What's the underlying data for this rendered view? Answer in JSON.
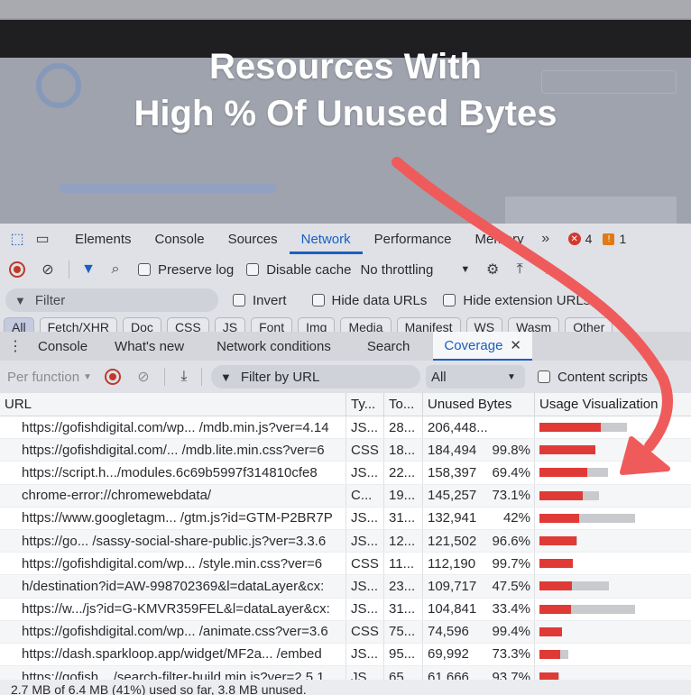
{
  "headline": {
    "line1": "Resources With",
    "line2": "High % Of Unused Bytes"
  },
  "devtools": {
    "main_tabs": [
      "Elements",
      "Console",
      "Sources",
      "Network",
      "Performance",
      "Memory"
    ],
    "active_tab": "Network",
    "more_tabs": "»",
    "errors": "4",
    "warnings": "1",
    "toolbar": {
      "preserve_log": "Preserve log",
      "disable_cache": "Disable cache",
      "throttling": "No throttling"
    },
    "filter": {
      "placeholder": "Filter",
      "invert": "Invert",
      "hide_data_urls": "Hide data URLs",
      "hide_extension_urls": "Hide extension URLs"
    },
    "type_chips": [
      "All",
      "Fetch/XHR",
      "Doc",
      "CSS",
      "JS",
      "Font",
      "Img",
      "Media",
      "Manifest",
      "WS",
      "Wasm",
      "Other"
    ],
    "drawer_tabs": [
      "Console",
      "What's new",
      "Network conditions",
      "Search",
      "Coverage"
    ],
    "active_drawer_tab": "Coverage",
    "coverage_toolbar": {
      "per_function": "Per function",
      "url_filter_placeholder": "Filter by URL",
      "type_select": "All",
      "content_scripts": "Content scripts"
    },
    "columns": {
      "url": "URL",
      "type": "Ty...",
      "total": "To...",
      "unused": "Unused Bytes",
      "viz": "Usage Visualization"
    },
    "rows": [
      {
        "url": "https://gofishdigital.com/wp... /mdb.min.js?ver=4.14",
        "type": "JS...",
        "total": "28...",
        "unused": "206,448...",
        "pct": "",
        "unused_frac": 0.62,
        "total_frac": 0.88
      },
      {
        "url": "https://gofishdigital.com/... /mdb.lite.min.css?ver=6",
        "type": "CSS",
        "total": "18...",
        "unused": "184,494",
        "pct": "99.8%",
        "unused_frac": 0.56,
        "total_frac": 0.56
      },
      {
        "url": "https://script.h.../modules.6c69b5997f314810cfe8",
        "type": "JS...",
        "total": "22...",
        "unused": "158,397",
        "pct": "69.4%",
        "unused_frac": 0.48,
        "total_frac": 0.69
      },
      {
        "url": "chrome-error://chromewebdata/",
        "type": "C...",
        "total": "19...",
        "unused": "145,257",
        "pct": "73.1%",
        "unused_frac": 0.44,
        "total_frac": 0.6
      },
      {
        "url": "https://www.googletagm... /gtm.js?id=GTM-P2BR7P",
        "type": "JS...",
        "total": "31...",
        "unused": "132,941",
        "pct": "42%",
        "unused_frac": 0.4,
        "total_frac": 0.96
      },
      {
        "url": "https://go... /sassy-social-share-public.js?ver=3.3.6",
        "type": "JS...",
        "total": "12...",
        "unused": "121,502",
        "pct": "96.6%",
        "unused_frac": 0.37,
        "total_frac": 0.38
      },
      {
        "url": "https://gofishdigital.com/wp... /style.min.css?ver=6",
        "type": "CSS",
        "total": "11...",
        "unused": "112,190",
        "pct": "99.7%",
        "unused_frac": 0.34,
        "total_frac": 0.34
      },
      {
        "url": "h/destination?id=AW-998702369&l=dataLayer&cx:",
        "type": "JS...",
        "total": "23...",
        "unused": "109,717",
        "pct": "47.5%",
        "unused_frac": 0.33,
        "total_frac": 0.7
      },
      {
        "url": "https://w.../js?id=G-KMVR359FEL&l=dataLayer&cx:",
        "type": "JS...",
        "total": "31...",
        "unused": "104,841",
        "pct": "33.4%",
        "unused_frac": 0.32,
        "total_frac": 0.96
      },
      {
        "url": "https://gofishdigital.com/wp... /animate.css?ver=3.6",
        "type": "CSS",
        "total": "75...",
        "unused": "74,596",
        "pct": "99.4%",
        "unused_frac": 0.23,
        "total_frac": 0.23
      },
      {
        "url": "https://dash.sparkloop.app/widget/MF2a... /embed",
        "type": "JS...",
        "total": "95...",
        "unused": "69,992",
        "pct": "73.3%",
        "unused_frac": 0.21,
        "total_frac": 0.29
      },
      {
        "url": "https://gofish... /search-filter-build.min.js?ver=2.5.1",
        "type": "JS...",
        "total": "65...",
        "unused": "61,666",
        "pct": "93.7%",
        "unused_frac": 0.19,
        "total_frac": 0.2
      }
    ],
    "status": "2.7 MB of 6.4 MB (41%) used so far, 3.8 MB unused."
  },
  "colors": {
    "unused_bar": "#e03a36",
    "used_bar": "#c9cacd",
    "arrow": "#ef5b5b",
    "accent": "#1a5fc2"
  }
}
